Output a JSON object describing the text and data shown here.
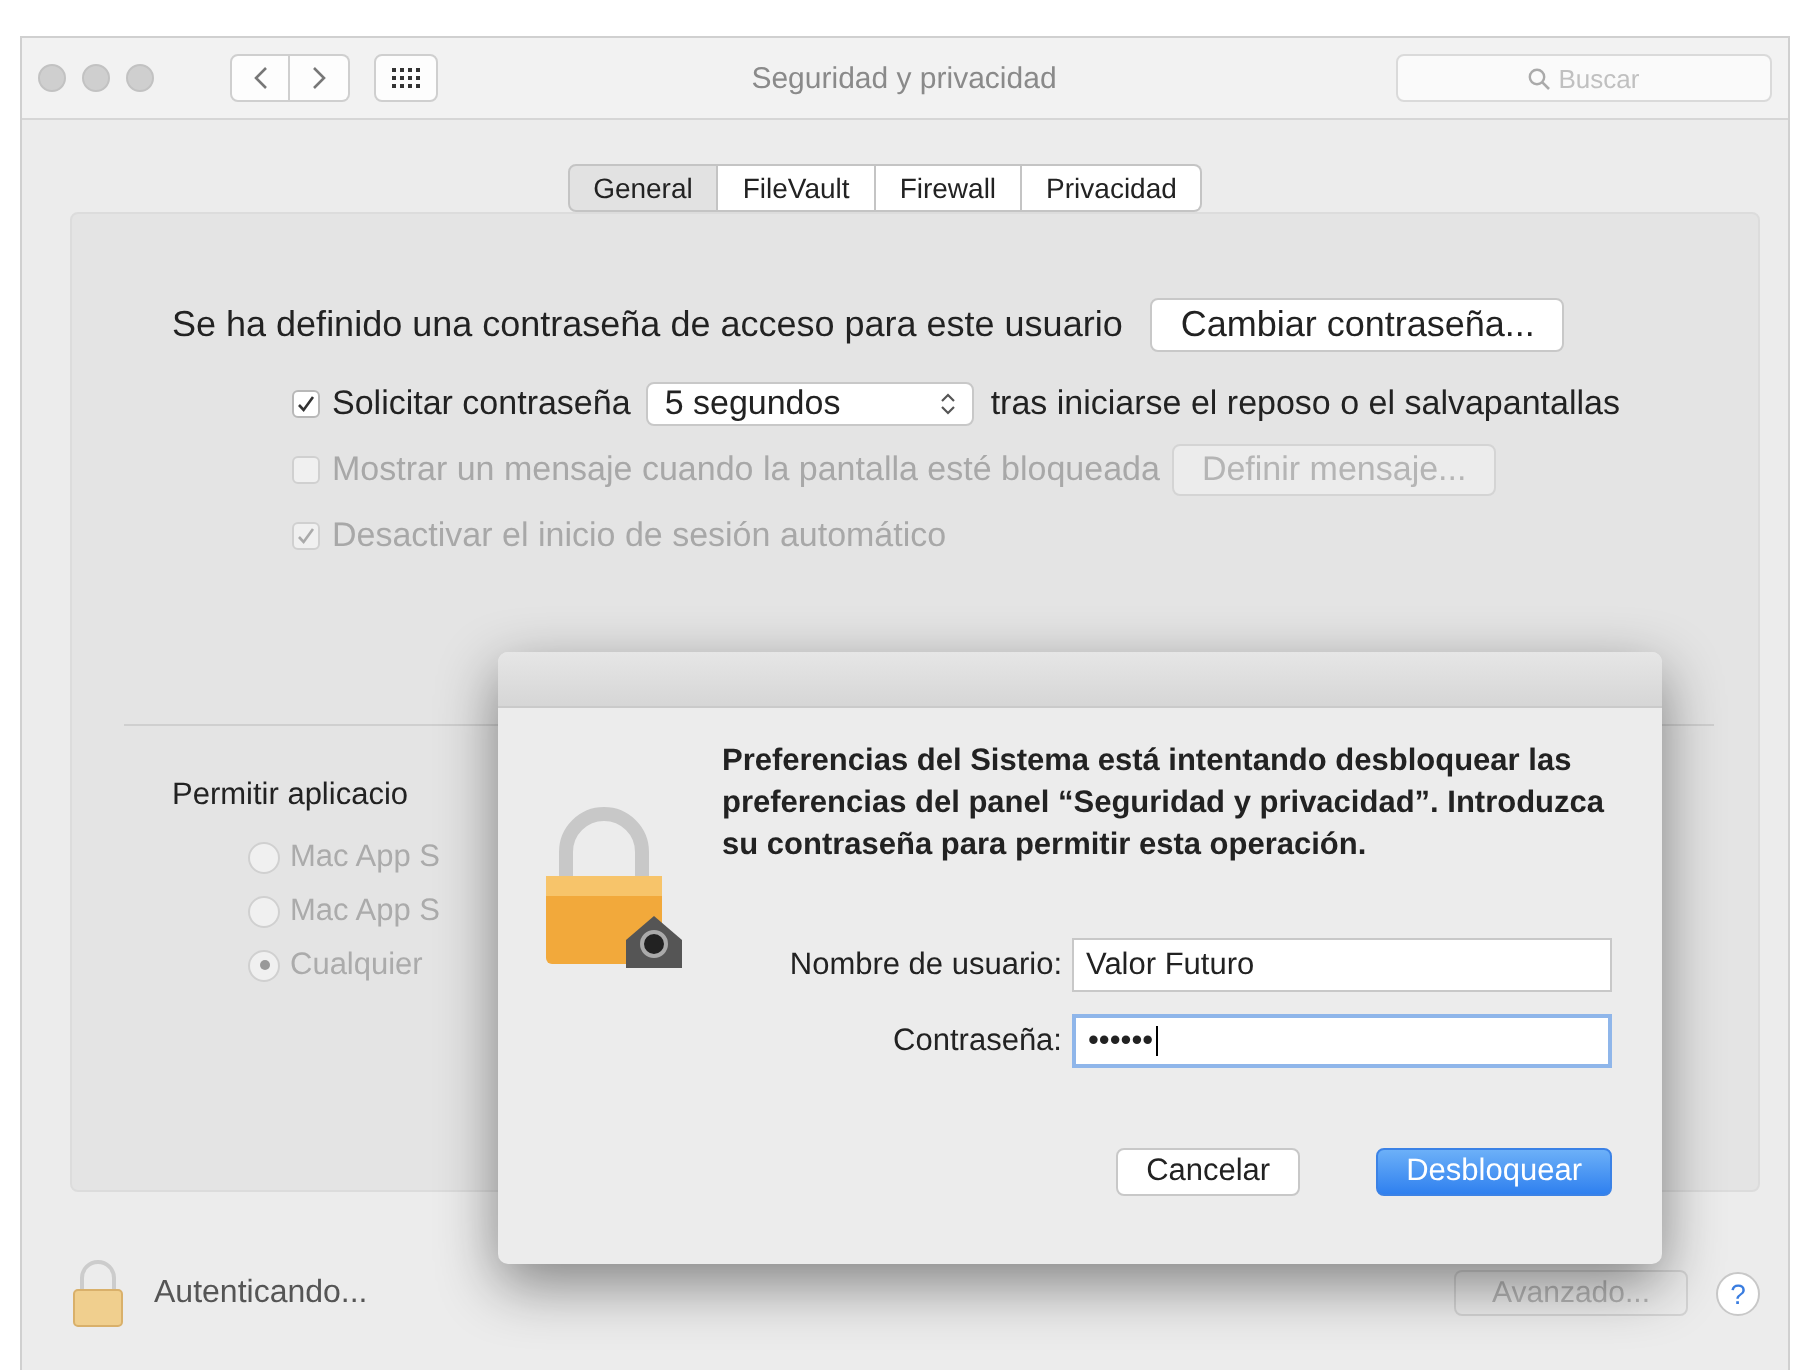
{
  "window": {
    "title": "Seguridad y privacidad",
    "search": {
      "placeholder": "Buscar"
    }
  },
  "tabs": [
    {
      "label": "General",
      "selected": true
    },
    {
      "label": "FileVault",
      "selected": false
    },
    {
      "label": "Firewall",
      "selected": false
    },
    {
      "label": "Privacidad",
      "selected": false
    }
  ],
  "general": {
    "password_text": "Se ha definido una contraseña de acceso para este usuario",
    "change_button": "Cambiar contraseña...",
    "options": [
      {
        "kind": "select",
        "label": "Solicitar contraseña",
        "checked": true,
        "disabled": false,
        "select": "5 segundos",
        "after": "tras iniciarse el reposo o el salvapantallas"
      },
      {
        "kind": "button",
        "label": "Mostrar un mensaje cuando la pantalla esté bloqueada",
        "checked": false,
        "disabled": true,
        "button": "Definir mensaje..."
      },
      {
        "kind": "plain",
        "label": "Desactivar el inicio de sesión automático",
        "checked": true,
        "disabled": true
      }
    ],
    "allow_label": "Permitir aplicacio",
    "radios": [
      {
        "label": "Mac App S",
        "selected": false
      },
      {
        "label": "Mac App S",
        "selected": false
      },
      {
        "label": "Cualquier",
        "selected": true
      }
    ]
  },
  "footer": {
    "status": "Autenticando...",
    "advanced_button": "Avanzado...",
    "help": "?"
  },
  "dialog": {
    "message": "Preferencias del Sistema está intentando desbloquear las preferencias del panel “Seguridad y privacidad”. Introduzca su contraseña para permitir esta operación.",
    "username_label": "Nombre de usuario:",
    "username": "Valor Futuro",
    "password_label": "Contraseña:",
    "password": "••••••",
    "password_focused": true,
    "cancel_button": "Cancelar",
    "unlock_button": "Desbloquear"
  }
}
